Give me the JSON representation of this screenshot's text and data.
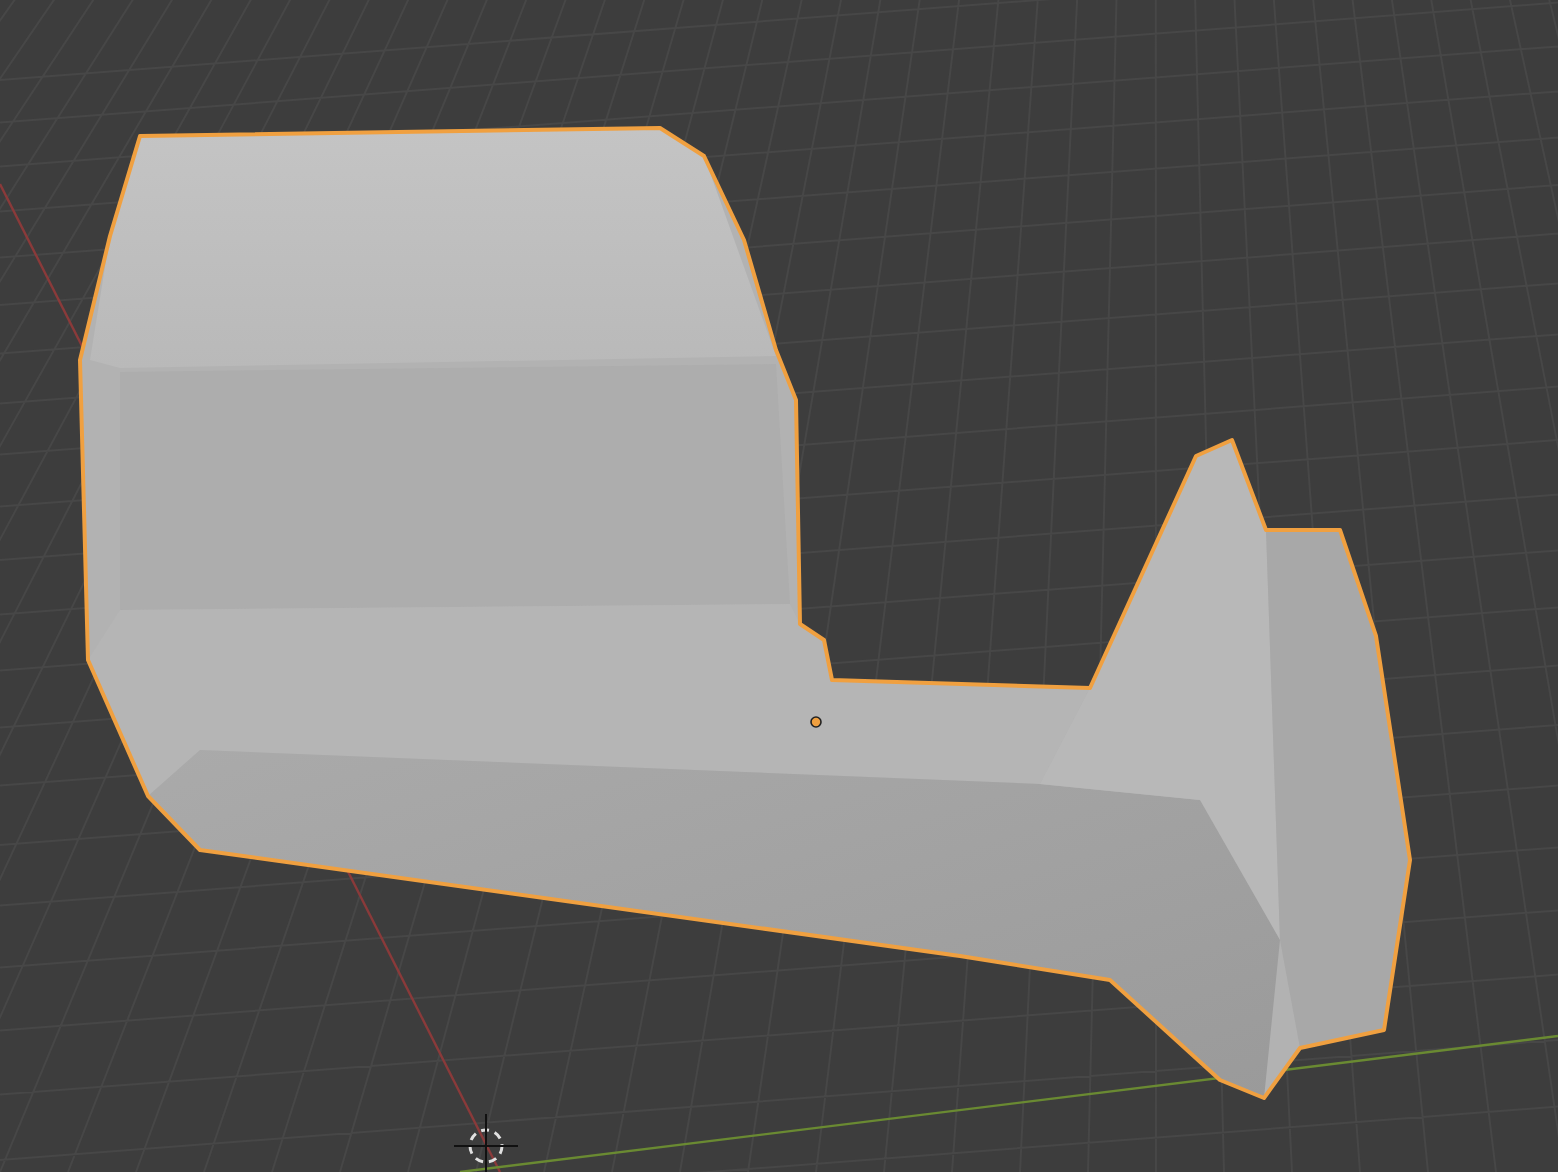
{
  "viewport": {
    "object_selected": true
  }
}
